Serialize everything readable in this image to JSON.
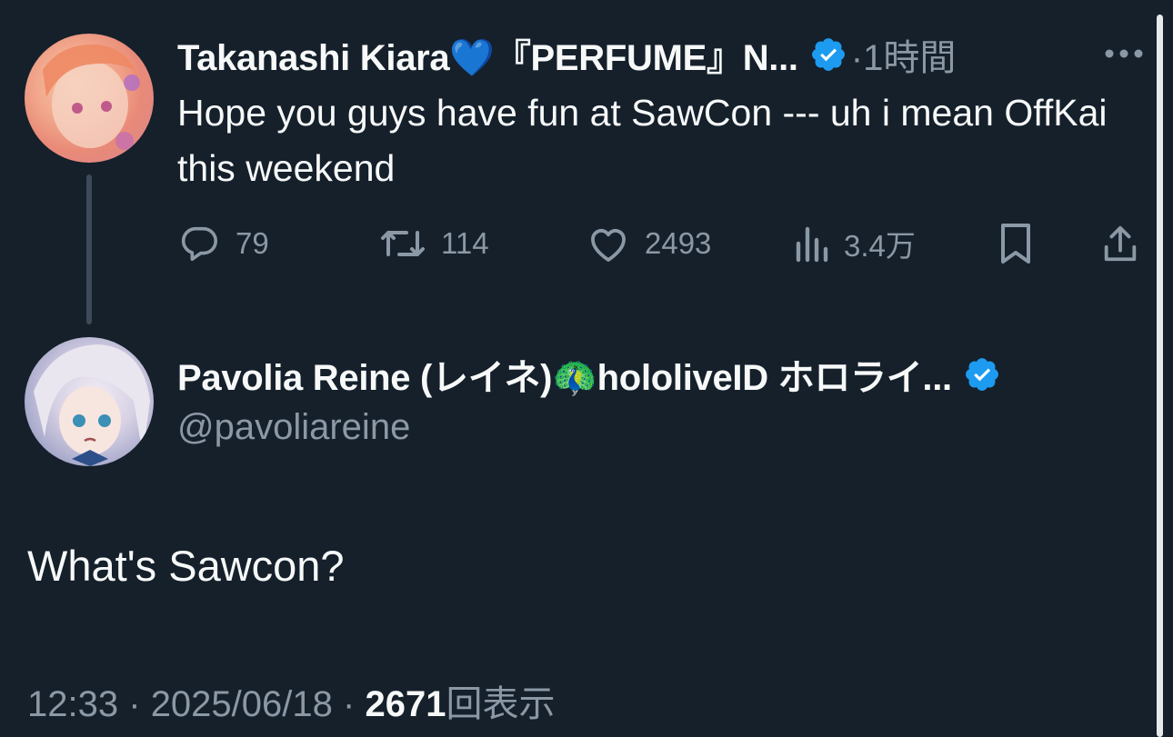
{
  "parent_tweet": {
    "display_name": "Takanashi Kiara💙『PERFUME』N...",
    "time": "1時間",
    "text": "Hope you guys have fun at SawCon --- uh i mean OffKai this weekend",
    "reply_count": "79",
    "retweet_count": "114",
    "like_count": "2493",
    "view_count": "3.4万"
  },
  "main_tweet": {
    "display_name": "Pavolia Reine (レイネ)🦚hololiveID ホロライ...",
    "handle": "@pavoliareine",
    "text": "What's Sawcon?",
    "time": "12:33",
    "date": "2025/06/18",
    "views_count": "2671",
    "views_label": "回表示"
  },
  "separator": "·",
  "colors": {
    "background": "#15202b",
    "primary_text": "#f7f9f9",
    "secondary_text": "#8b98a5",
    "verified_blue": "#1d9bf0",
    "thread_line": "#3d4a57"
  },
  "icons": [
    "more-icon",
    "reply-icon",
    "retweet-icon",
    "like-icon",
    "views-icon",
    "bookmark-icon",
    "share-icon",
    "verified-badge-icon"
  ]
}
